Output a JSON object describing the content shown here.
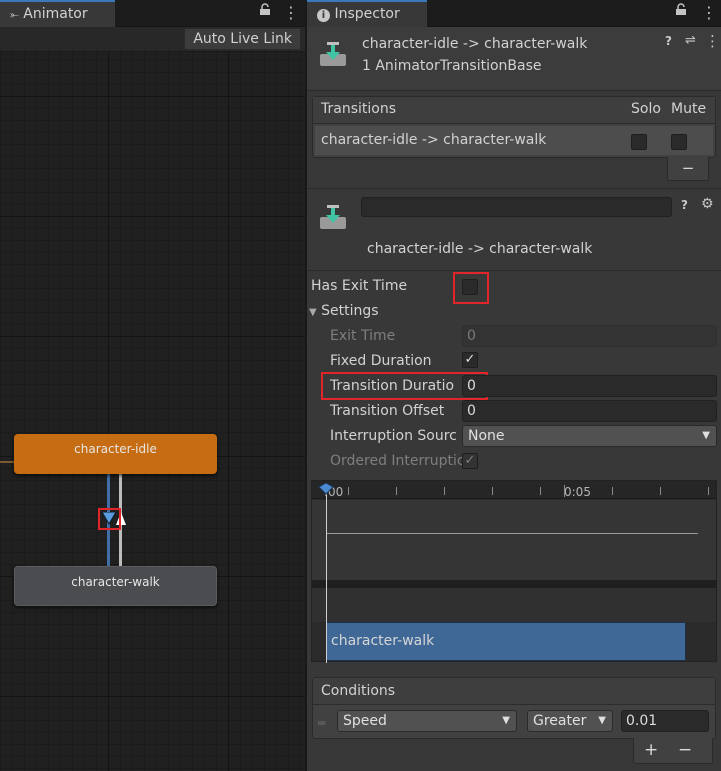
{
  "animator": {
    "tab_label": "Animator",
    "tab_icon": "animator-icon",
    "live_link_label": "Auto Live Link",
    "states": [
      {
        "name": "character-idle",
        "color": "#c66d13"
      },
      {
        "name": "character-walk",
        "color": "#4a4c4f"
      }
    ]
  },
  "inspector": {
    "tab_label": "Inspector",
    "header_title": "character-idle -> character-walk",
    "header_subtitle": "1 AnimatorTransitionBase",
    "transitions": {
      "header": "Transitions",
      "col_solo": "Solo",
      "col_mute": "Mute",
      "rows": [
        {
          "name": "character-idle -> character-walk",
          "solo": false,
          "mute": false
        }
      ],
      "remove_label": "−"
    },
    "transition_name_value": "",
    "transition_caption": "character-idle -> character-walk",
    "has_exit_time_label": "Has Exit Time",
    "has_exit_time": false,
    "settings_label": "Settings",
    "settings": {
      "exit_time_label": "Exit Time",
      "exit_time_value": "0",
      "fixed_duration_label": "Fixed Duration",
      "fixed_duration": true,
      "transition_duration_label": "Transition Duratio",
      "transition_duration_value": "0",
      "transition_offset_label": "Transition Offset",
      "transition_offset_value": "0",
      "interruption_source_label": "Interruption Sourc",
      "interruption_source_value": "None",
      "ordered_interruption_label": "Ordered Interruptic",
      "ordered_interruption": true
    },
    "timeline": {
      "tick_start": ":00",
      "tick_mid": "0:05",
      "clip_label": "character-walk",
      "accent": "#3f6897"
    },
    "conditions": {
      "header": "Conditions",
      "rows": [
        {
          "parameter": "Speed",
          "comparator": "Greater",
          "value": "0.01"
        }
      ],
      "add_label": "+",
      "remove_label": "−"
    }
  },
  "colors": {
    "highlight_red": "#e2252b",
    "tab_accent": "#3a79bb"
  }
}
